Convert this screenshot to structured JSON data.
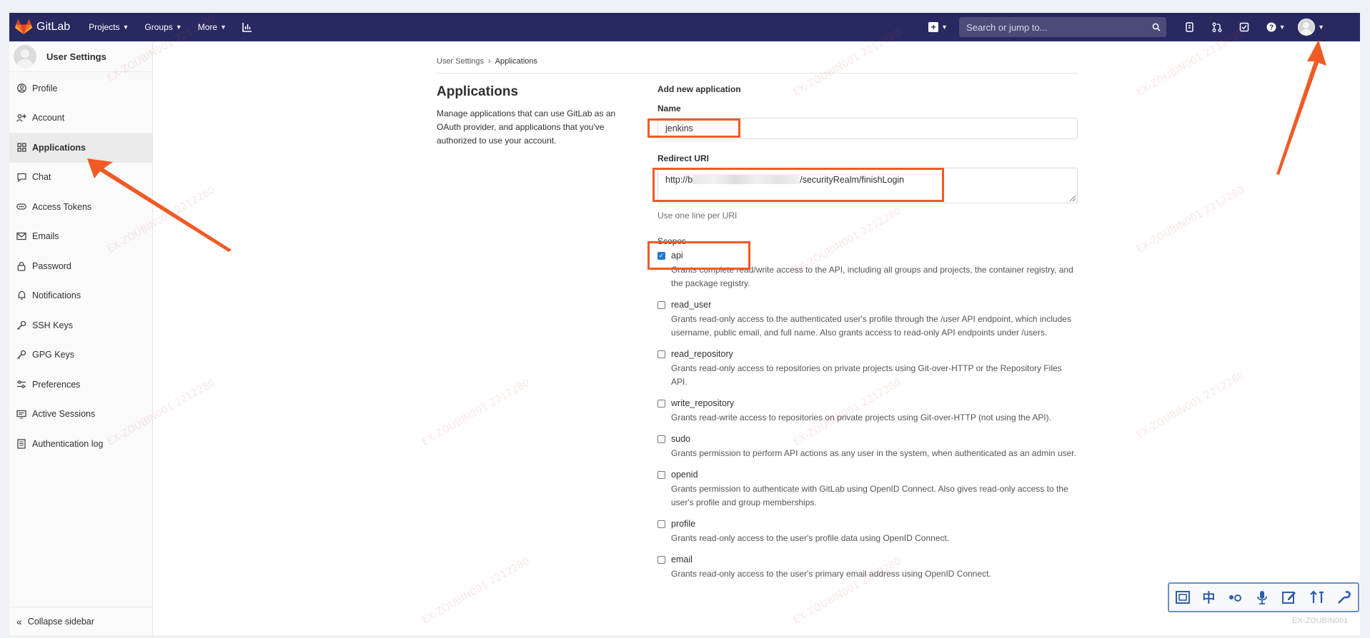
{
  "navbar": {
    "brand": "GitLab",
    "menu": [
      {
        "label": "Projects"
      },
      {
        "label": "Groups"
      },
      {
        "label": "More"
      }
    ],
    "search_placeholder": "Search or jump to..."
  },
  "sidebar": {
    "title": "User Settings",
    "items": [
      {
        "label": "Profile",
        "icon": "user-icon"
      },
      {
        "label": "Account",
        "icon": "account-icon"
      },
      {
        "label": "Applications",
        "icon": "grid-icon",
        "active": true
      },
      {
        "label": "Chat",
        "icon": "chat-icon"
      },
      {
        "label": "Access Tokens",
        "icon": "token-icon"
      },
      {
        "label": "Emails",
        "icon": "mail-icon"
      },
      {
        "label": "Password",
        "icon": "lock-icon"
      },
      {
        "label": "Notifications",
        "icon": "bell-icon"
      },
      {
        "label": "SSH Keys",
        "icon": "key-icon"
      },
      {
        "label": "GPG Keys",
        "icon": "key-icon"
      },
      {
        "label": "Preferences",
        "icon": "sliders-icon"
      },
      {
        "label": "Active Sessions",
        "icon": "monitor-icon"
      },
      {
        "label": "Authentication log",
        "icon": "log-icon"
      }
    ],
    "collapse_label": "Collapse sidebar"
  },
  "breadcrumb": {
    "parent": "User Settings",
    "separator": "›",
    "current": "Applications"
  },
  "page": {
    "title": "Applications",
    "description": "Manage applications that can use GitLab as an OAuth provider, and applications that you've authorized to use your account."
  },
  "form": {
    "section_title": "Add new application",
    "name_label": "Name",
    "name_value": "jenkins",
    "redirect_label": "Redirect URI",
    "redirect_prefix": "http://b",
    "redirect_suffix": "/securityRealm/finishLogin",
    "redirect_help": "Use one line per URI",
    "scopes_label": "Scopes",
    "scopes": [
      {
        "name": "api",
        "checked": true,
        "description": "Grants complete read/write access to the API, including all groups and projects, the container registry, and the package registry."
      },
      {
        "name": "read_user",
        "checked": false,
        "description": "Grants read-only access to the authenticated user's profile through the /user API endpoint, which includes username, public email, and full name. Also grants access to read-only API endpoints under /users."
      },
      {
        "name": "read_repository",
        "checked": false,
        "description": "Grants read-only access to repositories on private projects using Git-over-HTTP or the Repository Files API."
      },
      {
        "name": "write_repository",
        "checked": false,
        "description": "Grants read-write access to repositories on private projects using Git-over-HTTP (not using the API)."
      },
      {
        "name": "sudo",
        "checked": false,
        "description": "Grants permission to perform API actions as any user in the system, when authenticated as an admin user."
      },
      {
        "name": "openid",
        "checked": false,
        "description": "Grants permission to authenticate with GitLab using OpenID Connect. Also gives read-only access to the user's profile and group memberships."
      },
      {
        "name": "profile",
        "checked": false,
        "description": "Grants read-only access to the user's profile data using OpenID Connect."
      },
      {
        "name": "email",
        "checked": false,
        "description": "Grants read-only access to the user's primary email address using OpenID Connect."
      }
    ]
  },
  "ime": {
    "keys": [
      "中"
    ],
    "label": "EX-ZOUBIN001"
  },
  "colors": {
    "navbar": "#292961",
    "highlight": "#f15a24",
    "checkbox": "#1f78d1"
  }
}
